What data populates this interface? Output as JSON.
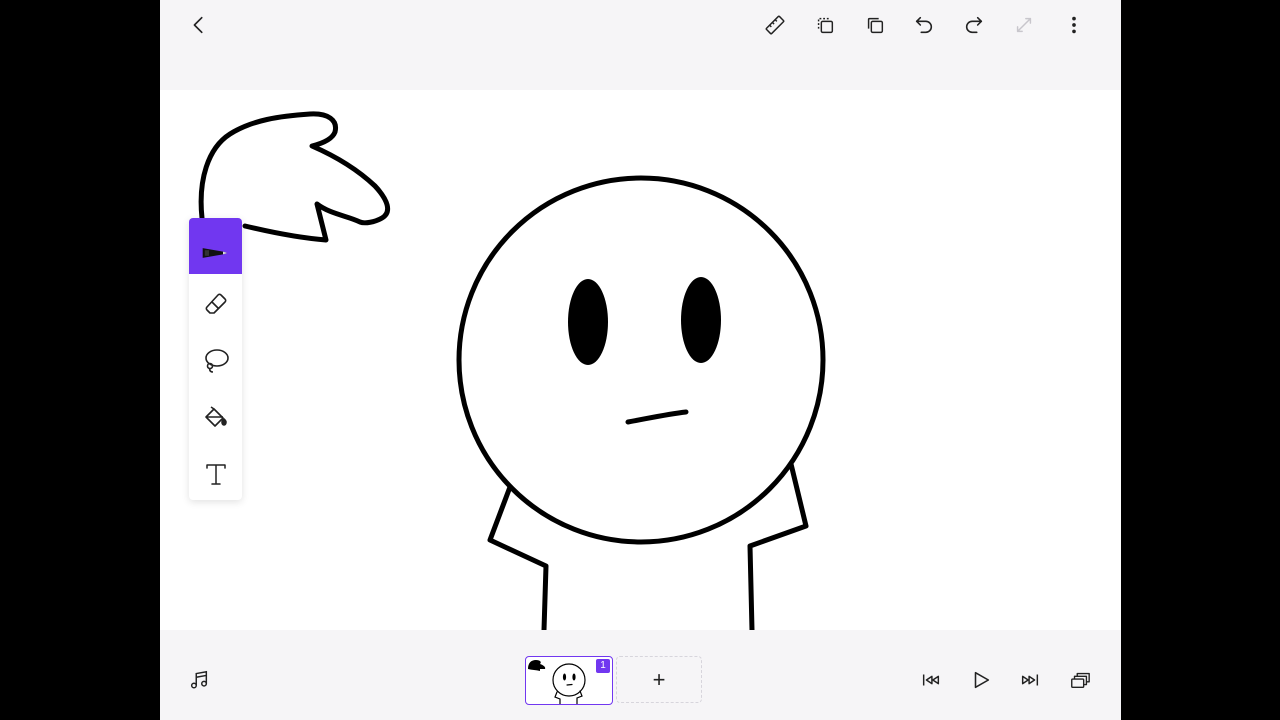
{
  "topbar": {
    "icons": {
      "back": "chevron-left-icon",
      "ruler": "ruler-icon",
      "duplicate": "duplicate-icon",
      "copy": "copy-icon",
      "undo": "undo-icon",
      "redo": "redo-icon",
      "resize": "resize-icon",
      "more": "more-vertical-icon"
    },
    "resize_enabled": false
  },
  "tools": [
    {
      "name": "pen",
      "icon": "pen-icon",
      "active": true
    },
    {
      "name": "eraser",
      "icon": "eraser-icon",
      "active": false
    },
    {
      "name": "lasso",
      "icon": "lasso-icon",
      "active": false
    },
    {
      "name": "fill",
      "icon": "paint-bucket-icon",
      "active": false
    },
    {
      "name": "text",
      "icon": "text-icon",
      "active": false
    }
  ],
  "timeline": {
    "frames": [
      {
        "number": "1",
        "selected": true
      }
    ],
    "add_frame_label": "+"
  },
  "playback": {
    "icons": [
      "music-icon",
      "skip-to-start-icon",
      "play-icon",
      "skip-to-end-icon",
      "layers-icon"
    ]
  },
  "colors": {
    "accent": "#7137f0",
    "bar_background": "#f6f5f7",
    "canvas_background": "#ffffff",
    "ink": "#000000"
  }
}
